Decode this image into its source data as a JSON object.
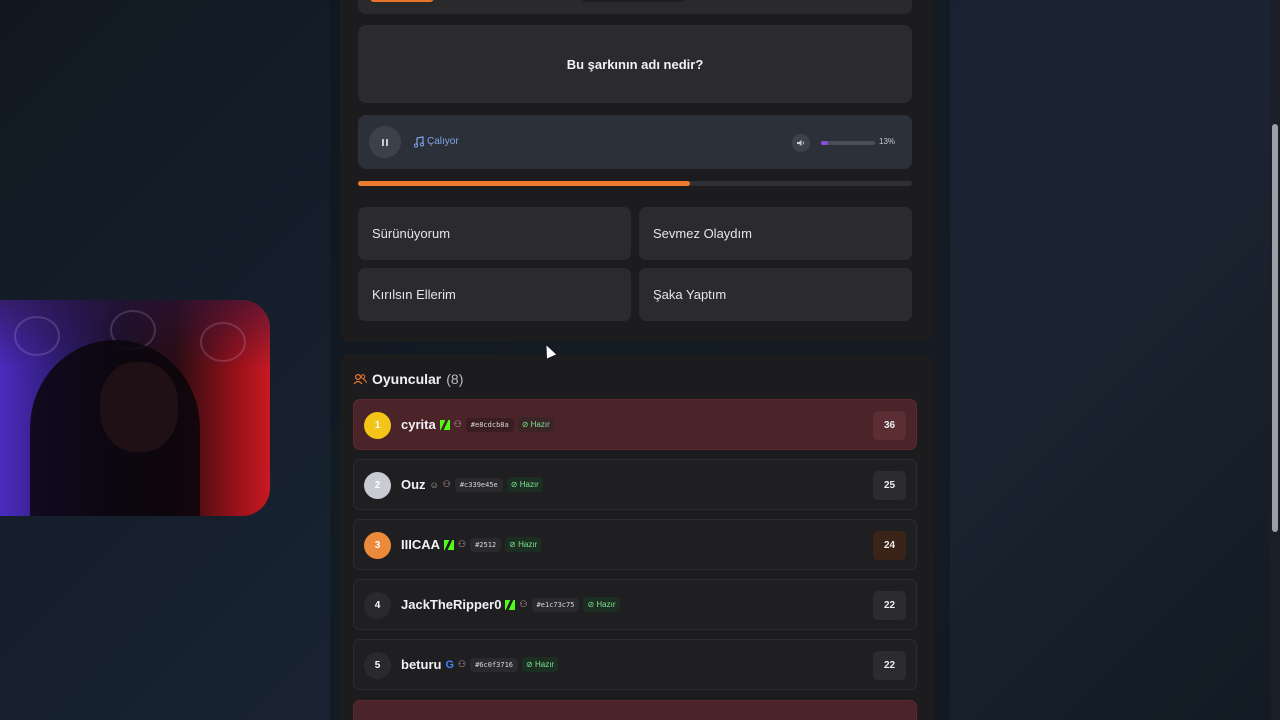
{
  "question": {
    "text": "Bu şarkının adı nedir?"
  },
  "player": {
    "status_label": "Çalıyor",
    "volume_label": "13%",
    "volume": 0.13,
    "progress": 0.6
  },
  "answers": [
    {
      "label": "Sürünüyorum"
    },
    {
      "label": "Sevmez Olaydım"
    },
    {
      "label": "Kırılsın Ellerim"
    },
    {
      "label": "Şaka Yaptım"
    }
  ],
  "players_section": {
    "title": "Oyuncular",
    "count": "(8)",
    "ready_label": "Hazır",
    "rows": [
      {
        "rank": "1",
        "name": "cyrita",
        "tag": "#e8cdcb8a",
        "score": "36"
      },
      {
        "rank": "2",
        "name": "Ouz",
        "tag": "#c339e45e",
        "score": "25"
      },
      {
        "rank": "3",
        "name": "IIICAA",
        "tag": "#2512",
        "score": "24"
      },
      {
        "rank": "4",
        "name": "JackTheRipper0",
        "tag": "#e1c73c75",
        "score": "22"
      },
      {
        "rank": "5",
        "name": "beturu",
        "tag": "#6c0f3716",
        "score": "22"
      }
    ]
  },
  "colors": {
    "accent_orange": "#ec7a30",
    "gold": "#f2c518",
    "silver": "#c9cbd2",
    "bronze": "#ec8a3c",
    "kick_green": "#53fc18",
    "ready_green": "#7fe28f"
  },
  "icons": [
    "pause-icon",
    "music-note-icon",
    "volume-icon",
    "users-icon",
    "kick-icon",
    "google-icon",
    "user-icon",
    "user-tag-icon",
    "check-circle-icon"
  ]
}
